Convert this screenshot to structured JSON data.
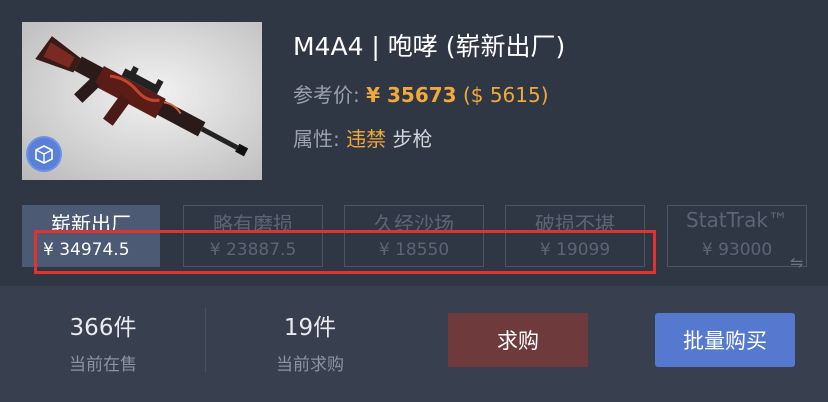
{
  "item": {
    "title": "M4A4 | 咆哮 (崭新出厂)",
    "ref_label": "参考价:",
    "ref_price": "¥ 35673",
    "ref_usd": "($ 5615)",
    "attr_label": "属性:",
    "attr_flag": "违禁",
    "attr_type": "步枪",
    "image_icon": "gun-icon",
    "badge_icon": "box-icon"
  },
  "wear_tabs": [
    {
      "name": "崭新出厂",
      "price": "¥ 34974.5",
      "active": true
    },
    {
      "name": "略有磨损",
      "price": "¥ 23887.5"
    },
    {
      "name": "久经沙场",
      "price": "¥ 18550"
    },
    {
      "name": "破损不堪",
      "price": "¥ 19099"
    },
    {
      "name": "StatTrak™",
      "price": "¥ 93000"
    }
  ],
  "swap_icon": "⇋",
  "stats": {
    "selling_count": "366件",
    "selling_label": "当前在售",
    "buying_count": "19件",
    "buying_label": "当前求购"
  },
  "buttons": {
    "buy_order": "求购",
    "bulk_buy": "批量购买"
  },
  "colors": {
    "accent_gold": "#f0a93b",
    "highlight_red": "#e0332f",
    "primary_blue": "#5479cf",
    "buy_order_red": "#6e3a3c"
  }
}
